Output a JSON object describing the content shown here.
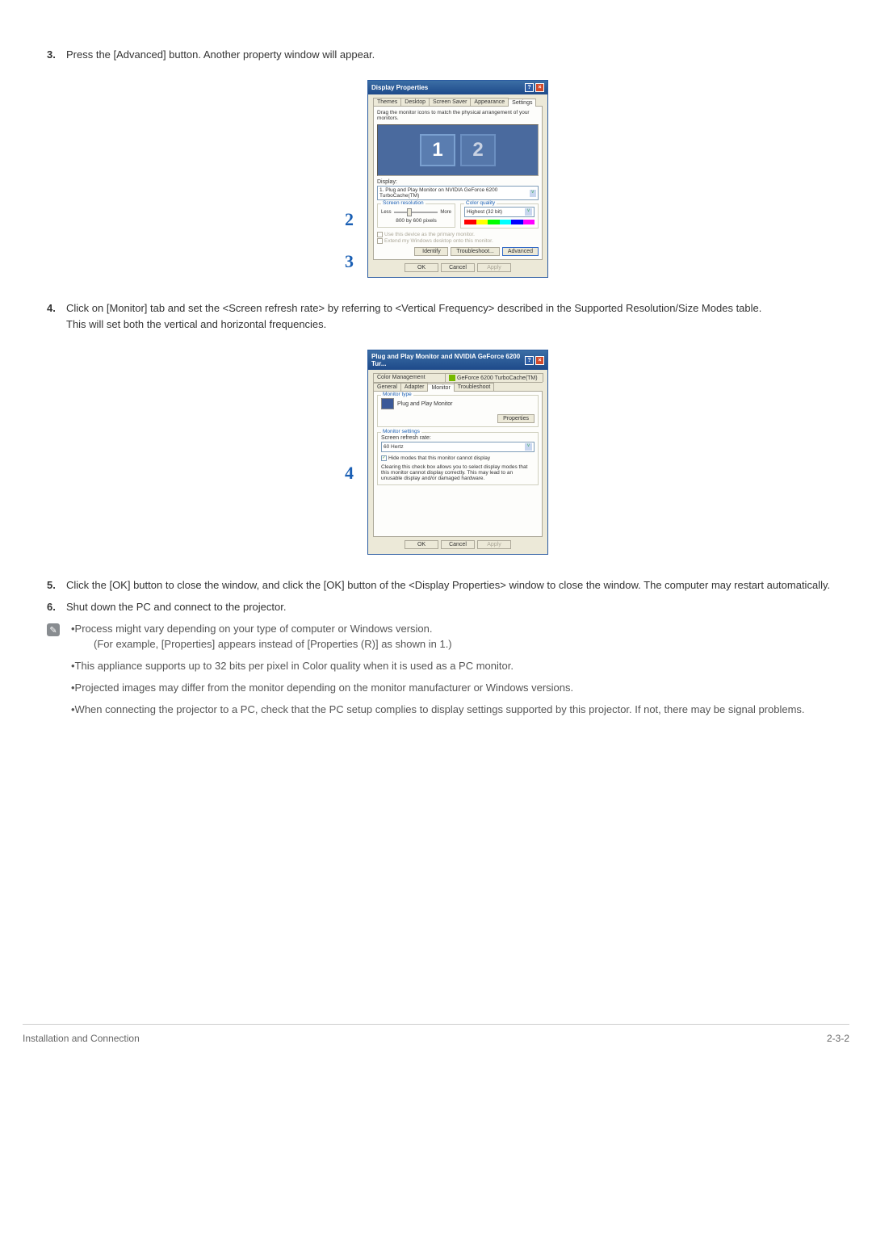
{
  "steps": {
    "s3": {
      "num": "3.",
      "text": "Press the [Advanced] button. Another property window will appear."
    },
    "s4": {
      "num": "4.",
      "text": "Click on [Monitor] tab and set the <Screen refresh rate> by referring to <Vertical Frequency> described in the Supported Resolution/Size Modes table.",
      "sub": "This will set both the vertical and horizontal frequencies."
    },
    "s5": {
      "num": "5.",
      "text": "Click the [OK] button to close the window, and click the [OK] button of the <Display Properties> window to close the window. The computer may restart automatically."
    },
    "s6": {
      "num": "6.",
      "text": "Shut down the PC and connect to the projector."
    }
  },
  "notes": {
    "n1": "•Process might vary depending on your type of computer or Windows version.",
    "n1sub": "(For example, [Properties] appears instead of [Properties (R)] as shown in 1.)",
    "n2": "•This appliance supports up to 32 bits per pixel in Color quality when it is used as a PC monitor.",
    "n3": "•Projected images may differ from the monitor depending on the monitor manufacturer or Windows versions.",
    "n4": "•When connecting the projector to a PC, check that the PC setup complies to display settings supported by this projector. If not, there may be signal problems."
  },
  "dialog1": {
    "title": "Display Properties",
    "tabs": {
      "t1": "Themes",
      "t2": "Desktop",
      "t3": "Screen Saver",
      "t4": "Appearance",
      "t5": "Settings"
    },
    "hint": "Drag the monitor icons to match the physical arrangement of your monitors.",
    "mon1": "1",
    "mon2": "2",
    "displayLabel": "Display:",
    "displayValue": "1. Plug and Play Monitor on NVIDIA GeForce 6200 TurboCache(TM)",
    "resLegend": "Screen resolution",
    "less": "Less",
    "more": "More",
    "resValue": "800 by 600  pixels",
    "qualLegend": "Color quality",
    "qualValue": "Highest (32 bit)",
    "chk1": "Use this device as the primary monitor.",
    "chk2": "Extend my Windows desktop onto this monitor.",
    "buttons": {
      "identify": "Identify",
      "trouble": "Troubleshoot...",
      "advanced": "Advanced",
      "ok": "OK",
      "cancel": "Cancel",
      "apply": "Apply"
    }
  },
  "dialog2": {
    "title": "Plug and Play Monitor and NVIDIA GeForce 6200 Tur...",
    "tabs": {
      "t1": "Color Management",
      "t2": "GeForce 6200 TurboCache(TM)",
      "t3": "General",
      "t4": "Adapter",
      "t5": "Monitor",
      "t6": "Troubleshoot"
    },
    "typeLegend": "Monitor type",
    "typeValue": "Plug and Play Monitor",
    "propsBtn": "Properties",
    "settingsLegend": "Monitor settings",
    "rateLabel": "Screen refresh rate:",
    "rateValue": "60 Hertz",
    "hideChk": "Hide modes that this monitor cannot display",
    "hideNote": "Clearing this check box allows you to select display modes that this monitor cannot display correctly. This may lead to an unusable display and/or damaged hardware.",
    "buttons": {
      "ok": "OK",
      "cancel": "Cancel",
      "apply": "Apply"
    }
  },
  "callouts": {
    "c2": "2",
    "c3": "3",
    "c4": "4"
  },
  "footer": {
    "left": "Installation and Connection",
    "right": "2-3-2"
  }
}
